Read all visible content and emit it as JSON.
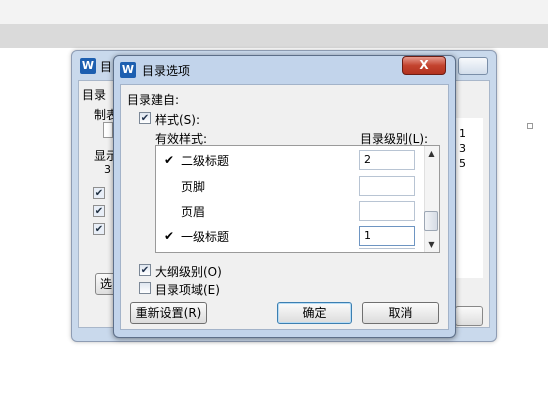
{
  "back_dialog": {
    "title": "目",
    "section_label": "目录",
    "row_label_1": "制表",
    "row_label_2": "显示",
    "row_value": "3",
    "numbers": [
      "1",
      "3",
      "5"
    ],
    "button_label": "选"
  },
  "dialog": {
    "title": "目录选项",
    "close_label": "X",
    "group_label": "目录建自:",
    "styles_checkbox": {
      "label": "样式(S):",
      "checked": true
    },
    "col_styles": "有效样式:",
    "col_level": "目录级别(L):",
    "rows": [
      {
        "name": "二级标题",
        "checked": true,
        "level": "2"
      },
      {
        "name": "页脚",
        "checked": false,
        "level": ""
      },
      {
        "name": "页眉",
        "checked": false,
        "level": ""
      },
      {
        "name": "一级标题",
        "checked": true,
        "level": "1"
      }
    ],
    "check_mark": "✔",
    "outline_checkbox": {
      "label": "大纲级别(O)",
      "checked": true
    },
    "fields_checkbox": {
      "label": "目录项域(E)",
      "checked": false
    },
    "buttons": {
      "reset": "重新设置(R)",
      "ok": "确定",
      "cancel": "取消"
    }
  },
  "icons": {
    "app_logo": "W",
    "up": "▲",
    "down": "▼",
    "check": "✔"
  }
}
